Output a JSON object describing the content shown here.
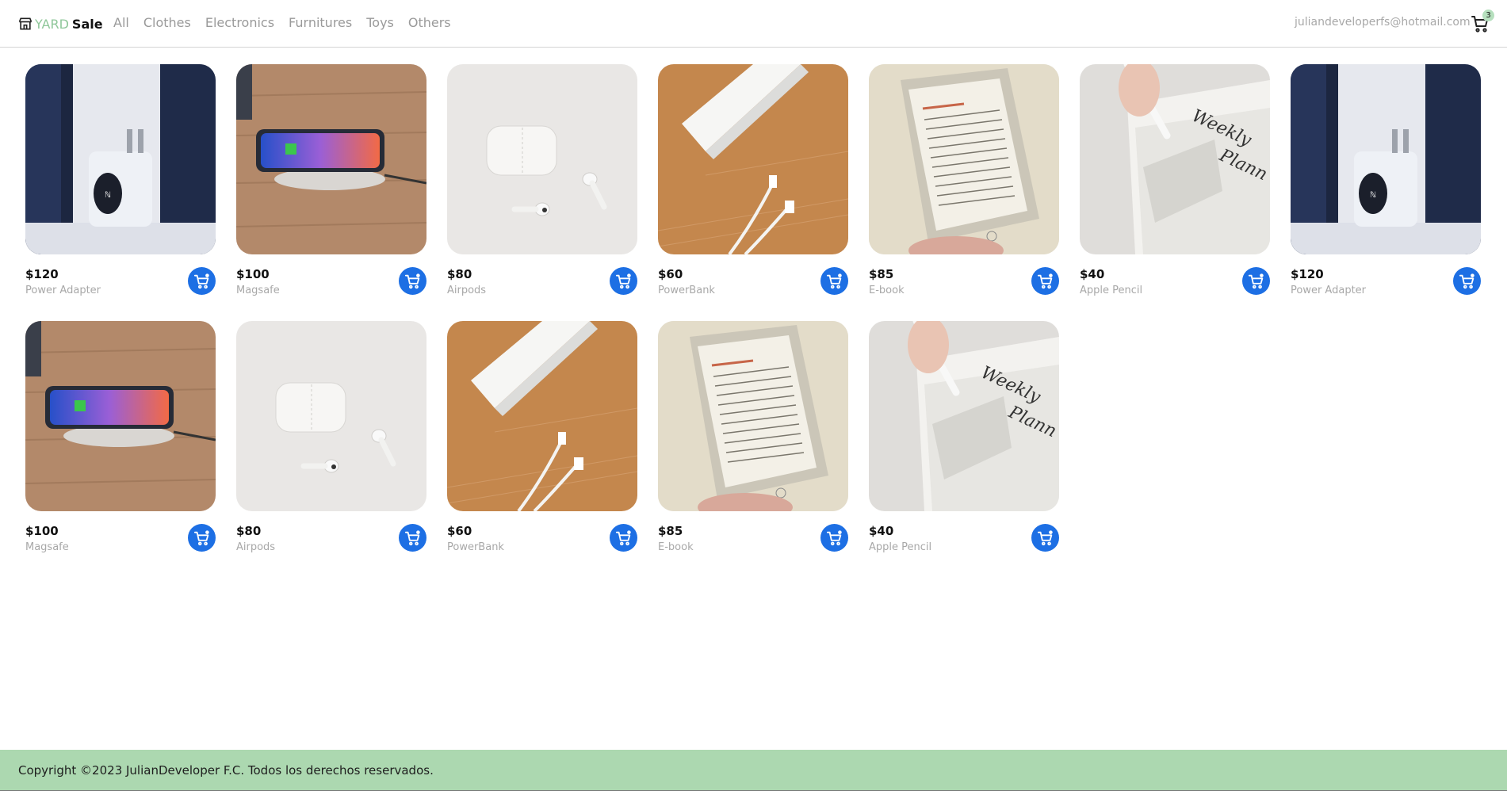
{
  "brand": {
    "icon": "storefront-icon",
    "yard": "YARD",
    "sale": "Sale"
  },
  "nav": [
    "All",
    "Clothes",
    "Electronics",
    "Furnitures",
    "Toys",
    "Others"
  ],
  "user": {
    "email": "juliandeveloperfs@hotmail.com"
  },
  "cart": {
    "icon": "cart-icon",
    "count": "3"
  },
  "colors": {
    "accent": "#1d6fe4",
    "brand_green": "#8fc79a",
    "footer_bg": "#acd8b0"
  },
  "products": [
    {
      "price": "$120",
      "name": "Power Adapter",
      "image": "power-adapter"
    },
    {
      "price": "$100",
      "name": "Magsafe",
      "image": "magsafe"
    },
    {
      "price": "$80",
      "name": "Airpods",
      "image": "airpods"
    },
    {
      "price": "$60",
      "name": "PowerBank",
      "image": "powerbank"
    },
    {
      "price": "$85",
      "name": "E-book",
      "image": "ebook"
    },
    {
      "price": "$40",
      "name": "Apple Pencil",
      "image": "apple-pencil"
    },
    {
      "price": "$120",
      "name": "Power Adapter",
      "image": "power-adapter"
    },
    {
      "price": "$100",
      "name": "Magsafe",
      "image": "magsafe"
    },
    {
      "price": "$80",
      "name": "Airpods",
      "image": "airpods"
    },
    {
      "price": "$60",
      "name": "PowerBank",
      "image": "powerbank"
    },
    {
      "price": "$85",
      "name": "E-book",
      "image": "ebook"
    },
    {
      "price": "$40",
      "name": "Apple Pencil",
      "image": "apple-pencil"
    }
  ],
  "footer": {
    "text": "Copyright ©2023 JulianDeveloper F.C. Todos los derechos reservados."
  }
}
